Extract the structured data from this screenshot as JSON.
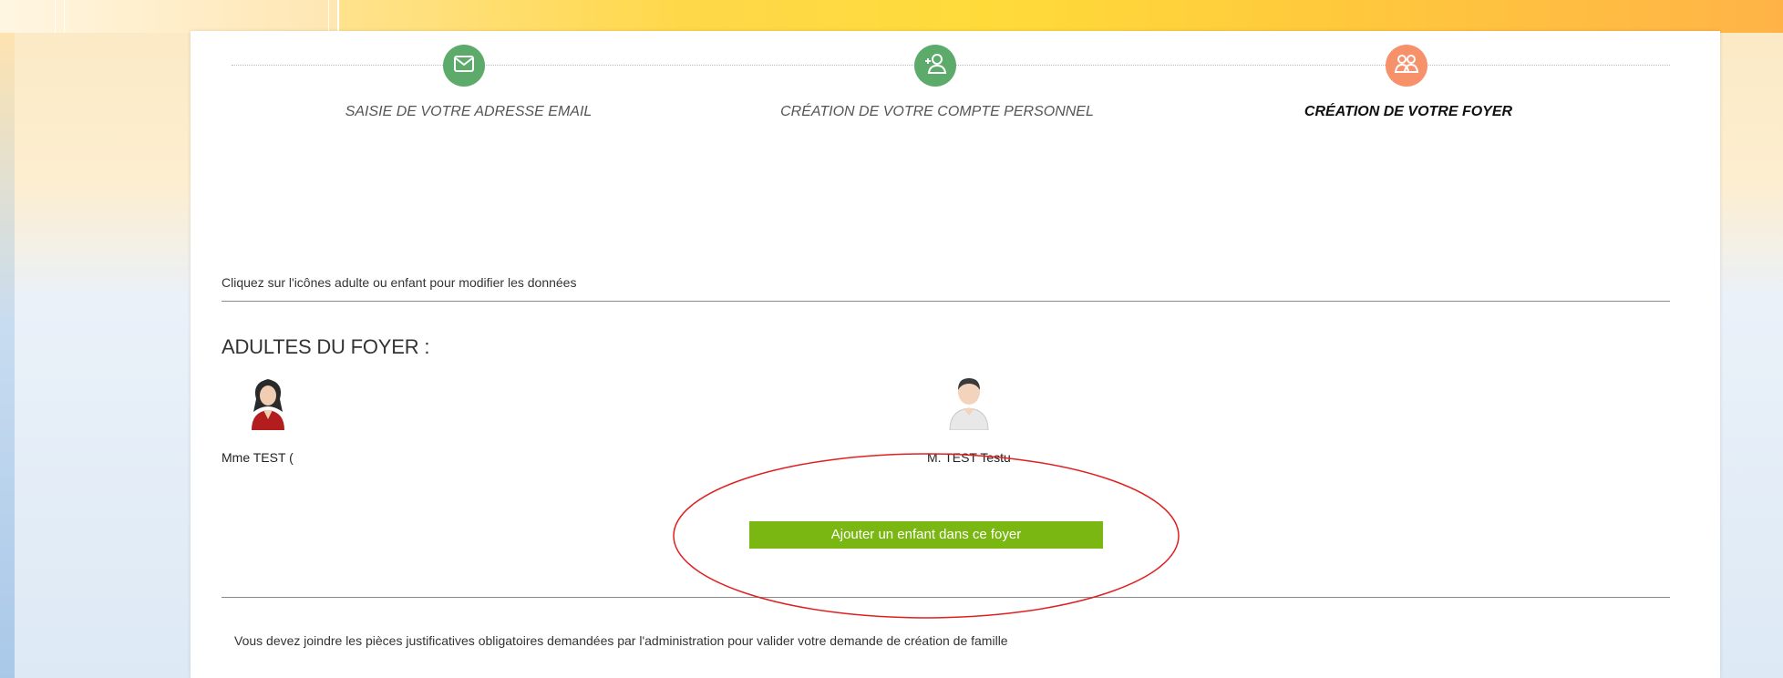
{
  "steps": [
    {
      "label": "SAISIE DE VOTRE ADRESSE EMAIL",
      "icon": "envelope-icon",
      "state": "done",
      "color": "#5cab6a"
    },
    {
      "label": "CRÉATION DE VOTRE COMPTE PERSONNEL",
      "icon": "add-person-icon",
      "state": "done",
      "color": "#5cab6a"
    },
    {
      "label": "CRÉATION DE VOTRE FOYER",
      "icon": "people-icon",
      "state": "active",
      "color": "#f6916a"
    }
  ],
  "instruction": "Cliquez sur l'icônes adulte ou enfant pour modifier les données",
  "adults": {
    "title": "ADULTES DU FOYER :",
    "members": [
      {
        "name": "Mme TEST (",
        "icon": "female-avatar-icon"
      },
      {
        "name": "M. TEST Testu",
        "icon": "male-avatar-icon"
      }
    ]
  },
  "add_child_button": "Ajouter un enfant dans ce foyer",
  "notice": "Vous devez joindre les pièces justificatives obligatoires demandées par l'administration pour valider votre demande de création de famille",
  "colors": {
    "accent_green": "#7ab712",
    "annotation_red": "#e02020"
  }
}
